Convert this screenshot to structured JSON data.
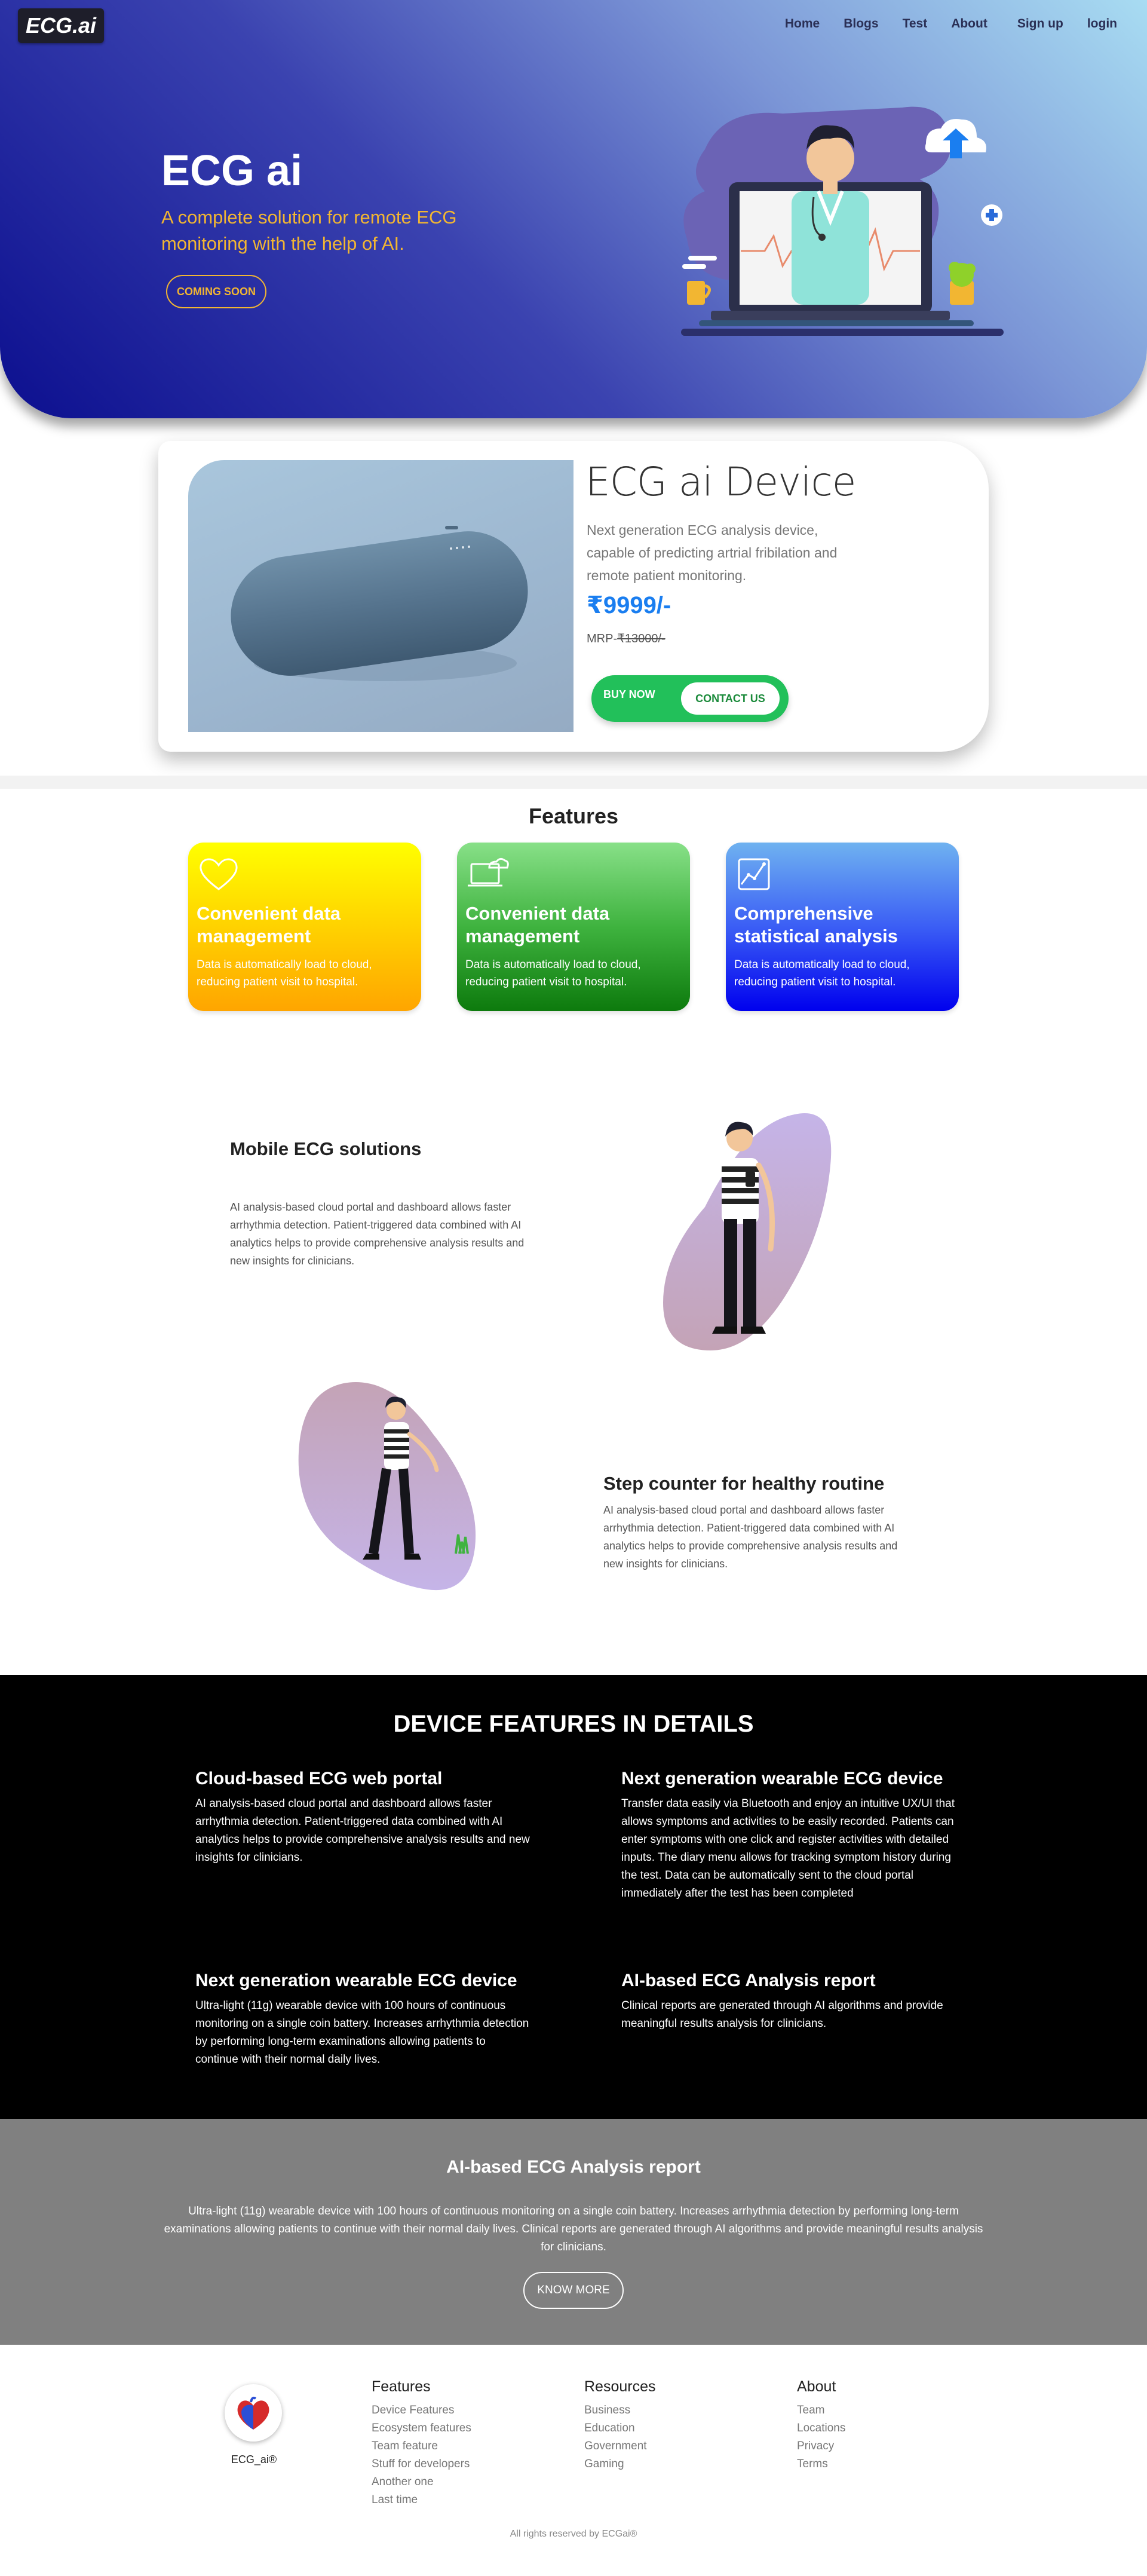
{
  "brand": {
    "logo_text": "ECG.ai"
  },
  "nav": {
    "items": [
      "Home",
      "Blogs",
      "Test",
      "About",
      "Sign up",
      "login"
    ]
  },
  "hero": {
    "title": "ECG ai",
    "subtitle": "A complete solution for remote ECG monitoring with the help of AI.",
    "cta_label": "COMING SOON",
    "accent_color": "#f2b632"
  },
  "device": {
    "title": "ECG ai Device",
    "description": "Next generation ECG analysis device, capable of predicting artrial fribilation and remote patient monitoring.",
    "price": "₹9999/-",
    "mrp_label": "MRP-",
    "mrp_value": "₹13000/-",
    "buy_label": "BUY NOW",
    "contact_label": "CONTACT US"
  },
  "features": {
    "heading": "Features",
    "cards": [
      {
        "icon": "heart-icon",
        "title": "Convenient data management",
        "desc": "Data is automatically load to cloud, reducing patient visit to hospital."
      },
      {
        "icon": "laptop-cloud-icon",
        "title": "Convenient data management",
        "desc": "Data is automatically load to cloud, reducing patient visit to hospital."
      },
      {
        "icon": "chart-icon",
        "title": "Comprehensive statistical analysis",
        "desc": "Data is automatically load to cloud, reducing patient visit to hospital."
      }
    ]
  },
  "solutions": [
    {
      "title": "Mobile ECG solutions",
      "desc": "AI analysis-based cloud portal and dashboard allows faster arrhythmia detection. Patient-triggered data combined with AI analytics helps to provide comprehensive analysis results and new insights for clinicians."
    },
    {
      "title": "Step counter for healthy routine",
      "desc": "AI analysis-based cloud portal and dashboard allows faster arrhythmia detection. Patient-triggered data combined with AI analytics helps to provide comprehensive analysis results and new insights for clinicians."
    }
  ],
  "device_features": {
    "heading": "DEVICE FEATURES IN DETAILS",
    "items": [
      {
        "title": "Cloud-based ECG web portal",
        "desc": "AI analysis-based cloud portal and dashboard allows faster arrhythmia detection. Patient-triggered data combined with AI analytics helps to provide comprehensive analysis results and new insights for clinicians."
      },
      {
        "title": "Next generation wearable ECG device",
        "desc": "Transfer data easily via Bluetooth and enjoy an intuitive UX/UI that allows symptoms and activities to be easily recorded. Patients can enter symptoms with one click and register activities with detailed inputs. The diary menu allows for tracking symptom history during the test. Data can be automatically sent to the cloud portal immediately after the test has been completed"
      },
      {
        "title": "Next generation wearable ECG device",
        "desc": "Ultra-light (11g) wearable device with 100 hours of continuous monitoring on a single coin battery. Increases arrhythmia detection by performing long-term examinations allowing patients to continue with their normal daily lives."
      },
      {
        "title": "AI-based ECG Analysis report",
        "desc": "Clinical reports are generated through AI algorithms and provide meaningful results analysis for clinicians."
      }
    ]
  },
  "report": {
    "title": "AI-based ECG Analysis report",
    "desc": "Ultra-light (11g) wearable device with 100 hours of continuous monitoring on a single coin battery. Increases arrhythmia detection by performing long-term examinations allowing patients to continue with their normal daily lives. Clinical reports are generated through AI algorithms and provide meaningful results analysis for clinicians.",
    "button_label": "KNOW MORE"
  },
  "footer": {
    "brand": "ECG_ai®",
    "columns": [
      {
        "heading": "Features",
        "links": [
          "Device Features",
          "Ecosystem features",
          "Team feature",
          "Stuff for developers",
          "Another one",
          "Last time"
        ]
      },
      {
        "heading": "Resources",
        "links": [
          "Business",
          "Education",
          "Government",
          "Gaming"
        ]
      },
      {
        "heading": "About",
        "links": [
          "Team",
          "Locations",
          "Privacy",
          "Terms"
        ]
      }
    ],
    "copyright": "All rights reserved by ECGai®"
  }
}
